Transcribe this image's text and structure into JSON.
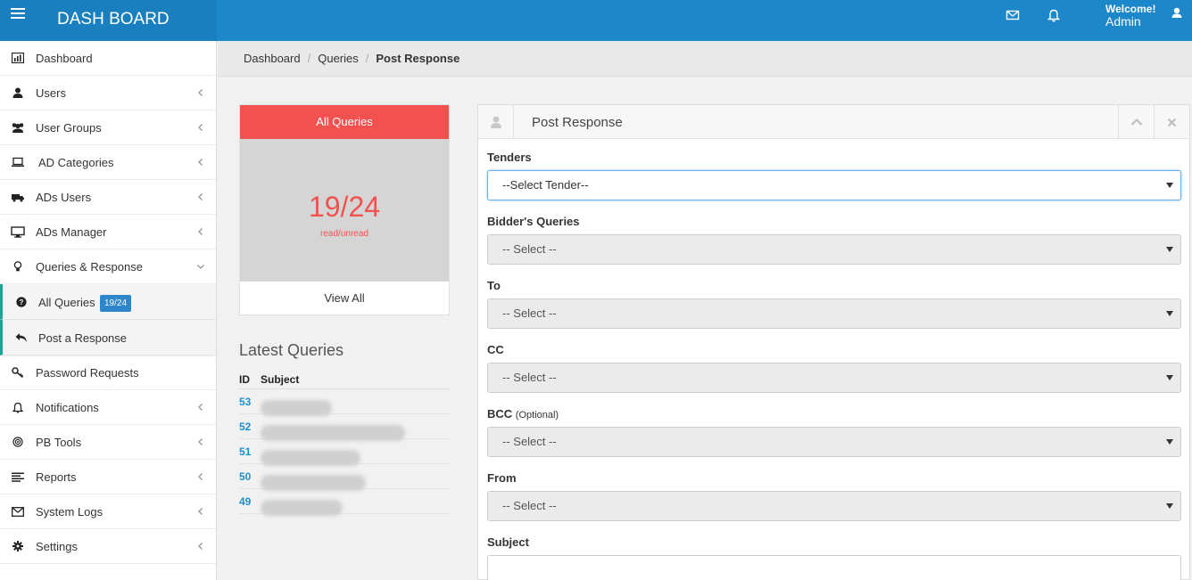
{
  "header": {
    "brand": "DASH BOARD",
    "welcome_line1": "Welcome!",
    "welcome_line2": "Admin"
  },
  "sidebar": {
    "items": [
      {
        "label": "Dashboard",
        "icon": "bar-chart-icon"
      },
      {
        "label": "Users",
        "icon": "user-icon"
      },
      {
        "label": "User Groups",
        "icon": "users-icon"
      },
      {
        "label": "AD Categories",
        "icon": "laptop-icon"
      },
      {
        "label": "ADs Users",
        "icon": "truck-icon"
      },
      {
        "label": "ADs Manager",
        "icon": "monitor-icon"
      },
      {
        "label": "Queries & Response",
        "icon": "lightbulb-icon"
      },
      {
        "label": "Password Requests",
        "icon": "key-icon"
      },
      {
        "label": "Notifications",
        "icon": "bell-icon"
      },
      {
        "label": "PB Tools",
        "icon": "target-icon"
      },
      {
        "label": "Reports",
        "icon": "list-icon"
      },
      {
        "label": "System Logs",
        "icon": "envelope-icon"
      },
      {
        "label": "Settings",
        "icon": "gear-icon"
      }
    ],
    "sub_items": [
      {
        "label": "All Queries",
        "badge": "19/24",
        "icon": "question-icon"
      },
      {
        "label": "Post a Response",
        "icon": "reply-icon"
      }
    ]
  },
  "breadcrumb": {
    "items": [
      "Dashboard",
      "Queries",
      "Post Response"
    ]
  },
  "stat_card": {
    "title": "All Queries",
    "value": "19/24",
    "caption": "read/unread",
    "footer": "View All"
  },
  "latest_queries": {
    "title": "Latest Queries",
    "col_id": "ID",
    "col_subject": "Subject",
    "rows": [
      {
        "id": "53"
      },
      {
        "id": "52"
      },
      {
        "id": "51"
      },
      {
        "id": "50"
      },
      {
        "id": "49"
      }
    ]
  },
  "form": {
    "title": "Post Response",
    "fields": [
      {
        "label": "Tenders",
        "value": "--Select Tender--"
      },
      {
        "label": "Bidder's Queries",
        "value": "-- Select --"
      },
      {
        "label": "To",
        "value": "-- Select --"
      },
      {
        "label": "CC",
        "value": "-- Select --"
      },
      {
        "label": "BCC",
        "optional": "(Optional)",
        "value": "-- Select --"
      },
      {
        "label": "From",
        "value": "-- Select --"
      }
    ],
    "subject_label": "Subject"
  },
  "colors": {
    "header": "#1c87c9",
    "accent_red": "#f2524f",
    "badge": "#2c86c9",
    "link": "#1d8fd1"
  }
}
